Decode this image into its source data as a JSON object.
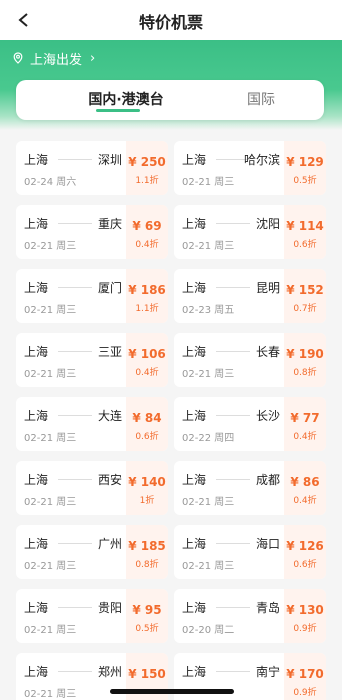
{
  "header": {
    "title": "特价机票",
    "back_icon": "back-arrow-icon"
  },
  "origin": {
    "label": "上海出发",
    "icon": "location-pin-icon"
  },
  "tabs": [
    {
      "label": "国内·港澳台",
      "active": true
    },
    {
      "label": "国际",
      "active": false
    }
  ],
  "colors": {
    "accent": "#3bbf86",
    "price": "#f26b2d",
    "price_bg": "#fff3ee"
  },
  "flights": [
    {
      "from": "上海",
      "to": "深圳",
      "date": "02-24 周六",
      "price": "¥ 250",
      "discount": "1.1折"
    },
    {
      "from": "上海",
      "to": "哈尔滨",
      "date": "02-21 周三",
      "price": "¥ 129",
      "discount": "0.5折"
    },
    {
      "from": "上海",
      "to": "重庆",
      "date": "02-21 周三",
      "price": "¥ 69",
      "discount": "0.4折"
    },
    {
      "from": "上海",
      "to": "沈阳",
      "date": "02-21 周三",
      "price": "¥ 114",
      "discount": "0.6折"
    },
    {
      "from": "上海",
      "to": "厦门",
      "date": "02-21 周三",
      "price": "¥ 186",
      "discount": "1.1折"
    },
    {
      "from": "上海",
      "to": "昆明",
      "date": "02-23 周五",
      "price": "¥ 152",
      "discount": "0.7折"
    },
    {
      "from": "上海",
      "to": "三亚",
      "date": "02-21 周三",
      "price": "¥ 106",
      "discount": "0.4折"
    },
    {
      "from": "上海",
      "to": "长春",
      "date": "02-21 周三",
      "price": "¥ 190",
      "discount": "0.8折"
    },
    {
      "from": "上海",
      "to": "大连",
      "date": "02-21 周三",
      "price": "¥ 84",
      "discount": "0.6折"
    },
    {
      "from": "上海",
      "to": "长沙",
      "date": "02-22 周四",
      "price": "¥ 77",
      "discount": "0.4折"
    },
    {
      "from": "上海",
      "to": "西安",
      "date": "02-21 周三",
      "price": "¥ 140",
      "discount": "1折"
    },
    {
      "from": "上海",
      "to": "成都",
      "date": "02-21 周三",
      "price": "¥ 86",
      "discount": "0.4折"
    },
    {
      "from": "上海",
      "to": "广州",
      "date": "02-21 周三",
      "price": "¥ 185",
      "discount": "0.8折"
    },
    {
      "from": "上海",
      "to": "海口",
      "date": "02-21 周三",
      "price": "¥ 126",
      "discount": "0.6折"
    },
    {
      "from": "上海",
      "to": "贵阳",
      "date": "02-21 周三",
      "price": "¥ 95",
      "discount": "0.5折"
    },
    {
      "from": "上海",
      "to": "青岛",
      "date": "02-20 周二",
      "price": "¥ 130",
      "discount": "0.9折"
    },
    {
      "from": "上海",
      "to": "郑州",
      "date": "02-21 周三",
      "price": "¥ 150",
      "discount": ""
    },
    {
      "from": "上海",
      "to": "南宁",
      "date": "",
      "price": "¥ 170",
      "discount": "0.9折"
    }
  ]
}
